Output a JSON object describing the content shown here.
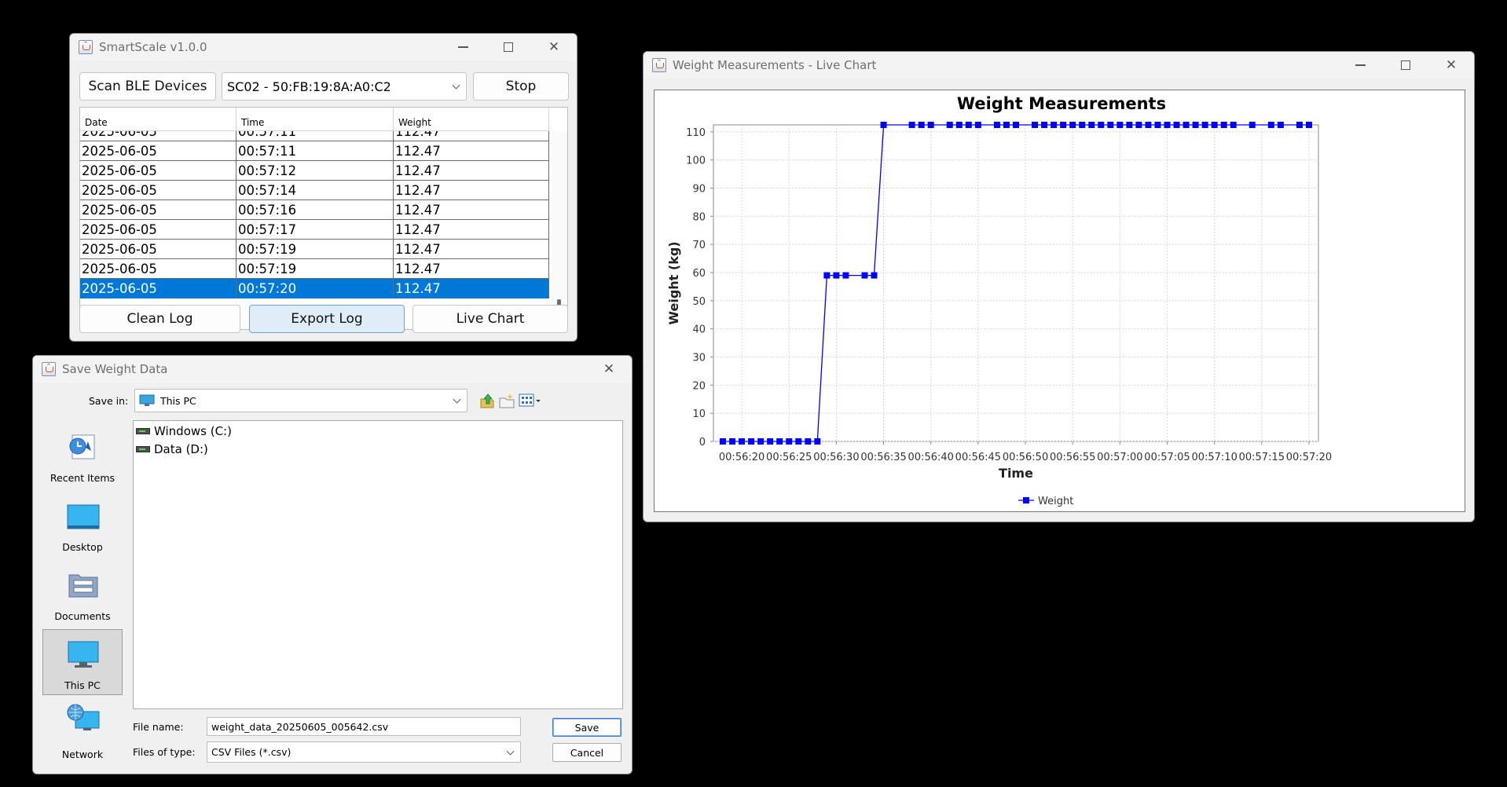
{
  "smartscale": {
    "title": "SmartScale v1.0.0",
    "scan_button": "Scan BLE Devices",
    "device_selected": "SC02 - 50:FB:19:8A:A0:C2",
    "stop_button": "Stop",
    "table": {
      "columns": [
        "Date",
        "Time",
        "Weight"
      ],
      "partial_row": [
        "2025-06-05",
        "00:57:11",
        "112.47"
      ],
      "rows": [
        [
          "2025-06-05",
          "00:57:11",
          "112.47"
        ],
        [
          "2025-06-05",
          "00:57:12",
          "112.47"
        ],
        [
          "2025-06-05",
          "00:57:14",
          "112.47"
        ],
        [
          "2025-06-05",
          "00:57:16",
          "112.47"
        ],
        [
          "2025-06-05",
          "00:57:17",
          "112.47"
        ],
        [
          "2025-06-05",
          "00:57:19",
          "112.47"
        ],
        [
          "2025-06-05",
          "00:57:19",
          "112.47"
        ],
        [
          "2025-06-05",
          "00:57:20",
          "112.47"
        ]
      ],
      "selected_index": 7
    },
    "clean_log_button": "Clean Log",
    "export_log_button": "Export Log",
    "live_chart_button": "Live Chart"
  },
  "chart_window": {
    "title": "Weight Measurements - Live Chart"
  },
  "chart_data": {
    "type": "line",
    "title": "Weight Measurements",
    "xlabel": "Time",
    "ylabel": "Weight (kg)",
    "ylim": [
      0,
      112.47
    ],
    "yticks": [
      0,
      10,
      20,
      30,
      40,
      50,
      60,
      70,
      80,
      90,
      100,
      110
    ],
    "xlim": [
      "00:56:17",
      "00:57:21"
    ],
    "xticks": [
      "00:56:20",
      "00:56:25",
      "00:56:30",
      "00:56:35",
      "00:56:40",
      "00:56:45",
      "00:56:50",
      "00:56:55",
      "00:57:00",
      "00:57:05",
      "00:57:10",
      "00:57:15",
      "00:57:20"
    ],
    "grid": true,
    "legend_position": "bottom-center",
    "series": [
      {
        "name": "Weight",
        "color": "#0000ff",
        "marker": "square",
        "x": [
          "00:56:18",
          "00:56:19",
          "00:56:20",
          "00:56:21",
          "00:56:22",
          "00:56:23",
          "00:56:24",
          "00:56:25",
          "00:56:26",
          "00:56:27",
          "00:56:28",
          "00:56:29",
          "00:56:30",
          "00:56:31",
          "00:56:33",
          "00:56:34",
          "00:56:35",
          "00:56:38",
          "00:56:39",
          "00:56:40",
          "00:56:42",
          "00:56:43",
          "00:56:44",
          "00:56:45",
          "00:56:47",
          "00:56:48",
          "00:56:49",
          "00:56:51",
          "00:56:52",
          "00:56:53",
          "00:56:54",
          "00:56:55",
          "00:56:56",
          "00:56:57",
          "00:56:58",
          "00:56:59",
          "00:57:00",
          "00:57:01",
          "00:57:02",
          "00:57:03",
          "00:57:04",
          "00:57:05",
          "00:57:06",
          "00:57:07",
          "00:57:08",
          "00:57:09",
          "00:57:10",
          "00:57:11",
          "00:57:12",
          "00:57:14",
          "00:57:16",
          "00:57:17",
          "00:57:19",
          "00:57:20"
        ],
        "values": [
          0,
          0,
          0,
          0,
          0,
          0,
          0,
          0,
          0,
          0,
          0,
          59,
          59,
          59,
          59,
          59,
          112.47,
          112.47,
          112.47,
          112.47,
          112.47,
          112.47,
          112.47,
          112.47,
          112.47,
          112.47,
          112.47,
          112.47,
          112.47,
          112.47,
          112.47,
          112.47,
          112.47,
          112.47,
          112.47,
          112.47,
          112.47,
          112.47,
          112.47,
          112.47,
          112.47,
          112.47,
          112.47,
          112.47,
          112.47,
          112.47,
          112.47,
          112.47,
          112.47,
          112.47,
          112.47,
          112.47,
          112.47,
          112.47
        ]
      }
    ]
  },
  "save_dialog": {
    "title": "Save Weight Data",
    "save_in_label": "Save in:",
    "save_in_value": "This PC",
    "places": [
      "Recent Items",
      "Desktop",
      "Documents",
      "This PC",
      "Network"
    ],
    "selected_place": "This PC",
    "drives": [
      "Windows (C:)",
      "Data (D:)"
    ],
    "file_name_label": "File name:",
    "file_name_value": "weight_data_20250605_005642.csv",
    "file_type_label": "Files of type:",
    "file_type_value": "CSV Files (*.csv)",
    "save_button": "Save",
    "cancel_button": "Cancel"
  }
}
